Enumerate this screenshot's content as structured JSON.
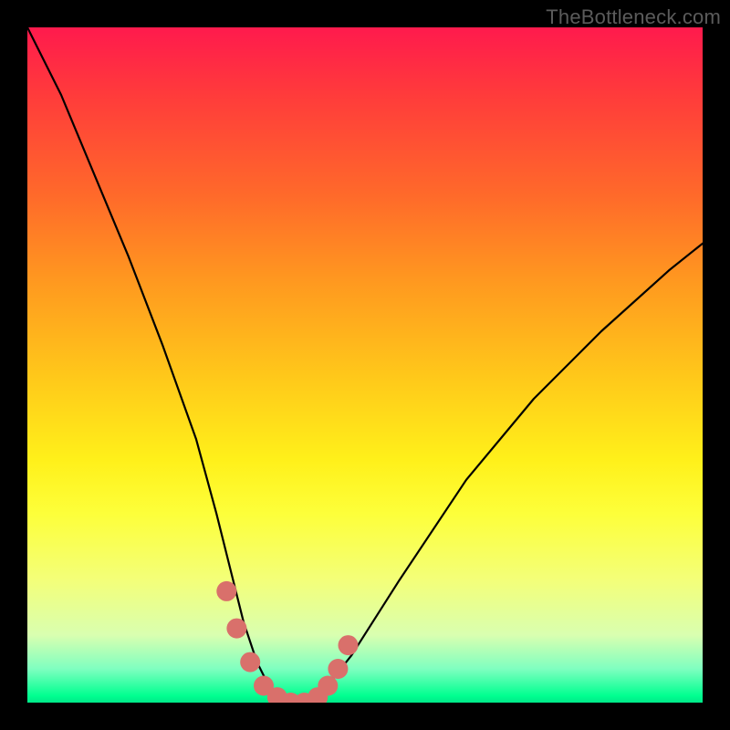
{
  "watermark": "TheBottleneck.com",
  "chart_data": {
    "type": "line",
    "title": "",
    "xlabel": "",
    "ylabel": "",
    "xlim": [
      0,
      100
    ],
    "ylim": [
      0,
      100
    ],
    "series": [
      {
        "name": "bottleneck-curve",
        "x": [
          0,
          5,
          10,
          15,
          20,
          25,
          28,
          30,
          32,
          34,
          36,
          38,
          40,
          42,
          44,
          48,
          55,
          65,
          75,
          85,
          95,
          100
        ],
        "values": [
          100,
          90,
          78,
          66,
          53,
          39,
          28,
          20,
          12,
          6,
          2,
          0,
          0,
          0,
          2,
          7,
          18,
          33,
          45,
          55,
          64,
          68
        ]
      }
    ],
    "markers": {
      "name": "highlight-dots",
      "x": [
        29.5,
        31.0,
        33.0,
        35.0,
        37.0,
        39.0,
        41.0,
        43.0,
        44.5,
        46.0,
        47.5
      ],
      "values": [
        16.5,
        11.0,
        6.0,
        2.5,
        0.8,
        0.0,
        0.0,
        0.8,
        2.5,
        5.0,
        8.5
      ]
    },
    "colors": {
      "curve": "#000000",
      "markers": "#d9706b"
    }
  }
}
